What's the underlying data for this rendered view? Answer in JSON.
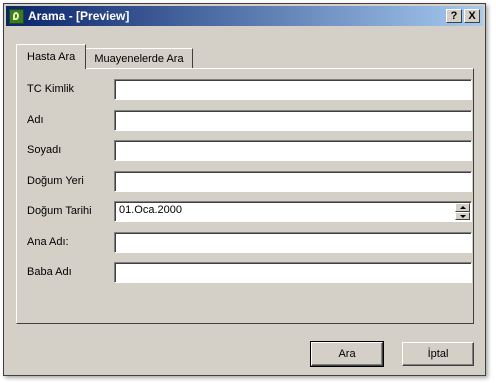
{
  "window": {
    "title": "Arama - [Preview]"
  },
  "titlebar_buttons": {
    "help": "?",
    "close": "X"
  },
  "tabs": [
    {
      "label": "Hasta Ara",
      "active": true
    },
    {
      "label": "Muayenelerde Ara",
      "active": false
    }
  ],
  "form": {
    "tc_label": "TC Kimlik",
    "tc_value": "",
    "adi_label": "Adı",
    "adi_value": "",
    "soyadi_label": "Soyadı",
    "soyadi_value": "",
    "dogum_yeri_label": "Doğum Yeri",
    "dogum_yeri_value": "",
    "dogum_tarihi_label": "Doğum Tarihi",
    "dogum_tarihi_value": "01.Oca.2000",
    "ana_adi_label": "Ana Adı:",
    "ana_adi_value": "",
    "baba_adi_label": "Baba Adı",
    "baba_adi_value": ""
  },
  "buttons": {
    "search": "Ara",
    "cancel": "İptal"
  },
  "icons": {
    "app": "app-icon",
    "spin": "spin-icon"
  },
  "colors": {
    "titlebar_start": "#0a246a",
    "titlebar_end": "#a6caf0",
    "face": "#d4d0c8"
  }
}
